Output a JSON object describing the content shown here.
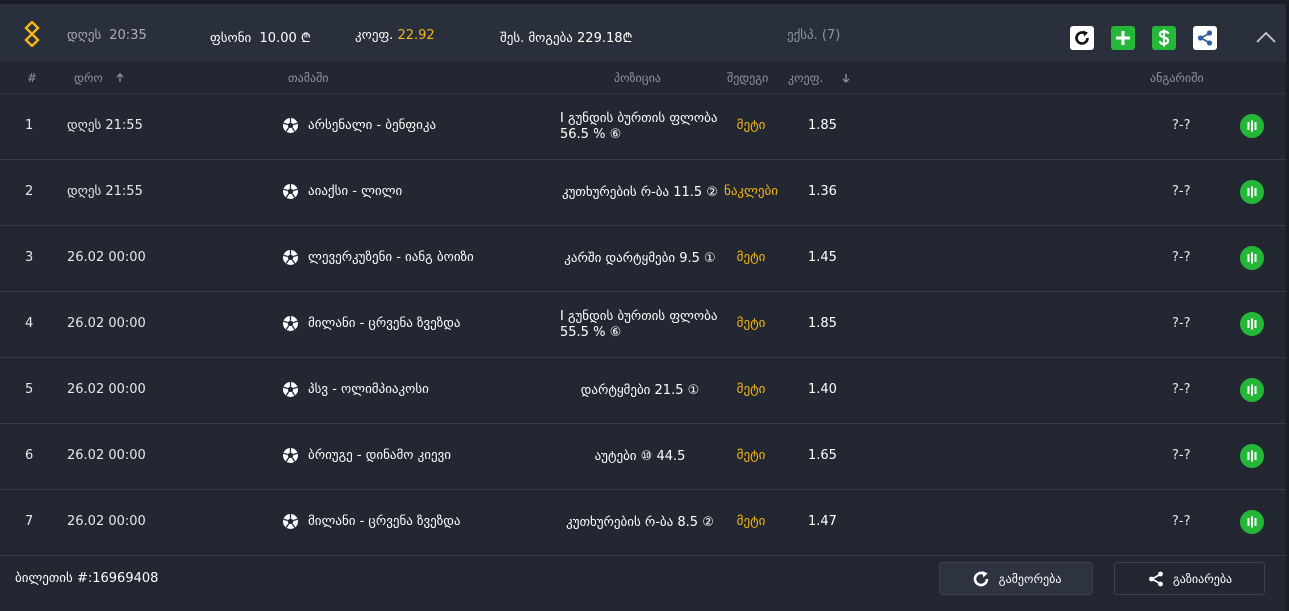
{
  "header": {
    "date_label": "დღეს",
    "time": "20:35",
    "stake_label": "ფსონი",
    "stake_value": "10.00 ₾",
    "odds_label": "კოეფ.",
    "odds_value": "22.92",
    "win_label": "შეს. მოგება",
    "win_value": "229.18₾",
    "express_label": "ექსპ. (7)",
    "icons": [
      "logo-icon",
      "refresh-icon",
      "plus-icon",
      "dollar-icon",
      "share-icon",
      "chevron-up-icon"
    ],
    "colors": {
      "accent": "#f5b614",
      "green": "#25b838"
    }
  },
  "columns": {
    "num": "#",
    "time": "დრო",
    "game": "თამაში",
    "position": "პოზიცია",
    "outcome": "შედეგი",
    "odds": "კოეფ.",
    "account": "ანგარიში"
  },
  "rows": [
    {
      "num": "1",
      "time": "დღეს  21:55",
      "game": "არსენალი - ბენფიკა",
      "position": "I გუნდის ბურთის ფლობა 56.5 % ⑥",
      "outcome": "მეტი",
      "odds": "1.85",
      "score": "?-?"
    },
    {
      "num": "2",
      "time": "დღეს  21:55",
      "game": "აიაქსი - ლილი",
      "position": "კუთხურების რ-ბა 11.5 ②",
      "outcome": "ნაკლები",
      "odds": "1.36",
      "score": "?-?"
    },
    {
      "num": "3",
      "time": "26.02  00:00",
      "game": "ლევერკუზენი - იანგ ბოიზი",
      "position": "კარში დარტყმები 9.5 ①",
      "outcome": "მეტი",
      "odds": "1.45",
      "score": "?-?"
    },
    {
      "num": "4",
      "time": "26.02  00:00",
      "game": "მილანი - ცრვენა ზვეზდა",
      "position": "I გუნდის ბურთის ფლობა 55.5 % ⑥",
      "outcome": "მეტი",
      "odds": "1.85",
      "score": "?-?"
    },
    {
      "num": "5",
      "time": "26.02  00:00",
      "game": "პსვ - ოლიმპიაკოსი",
      "position": "დარტყმები 21.5 ①",
      "outcome": "მეტი",
      "odds": "1.40",
      "score": "?-?"
    },
    {
      "num": "6",
      "time": "26.02  00:00",
      "game": "ბრიუგე - დინამო კიევი",
      "position": "აუტები ⑩ 44.5",
      "outcome": "მეტი",
      "odds": "1.65",
      "score": "?-?"
    },
    {
      "num": "7",
      "time": "26.02  00:00",
      "game": "მილანი - ცრვენა ზვეზდა",
      "position": "კუთხურების რ-ბა 8.5 ②",
      "outcome": "მეტი",
      "odds": "1.47",
      "score": "?-?"
    }
  ],
  "footer": {
    "ticket": "ბილეთის #:16969408",
    "repeat_label": "გამეორება",
    "share_label": "გაზიარება"
  }
}
